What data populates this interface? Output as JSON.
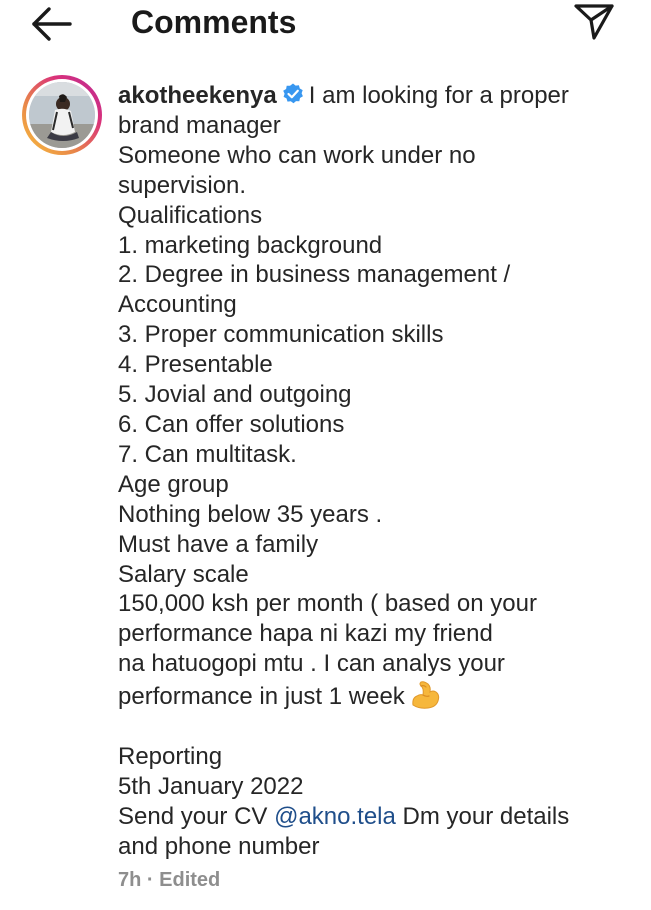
{
  "header": {
    "title": "Comments",
    "back_icon": "arrow-left-icon",
    "share_icon": "paper-plane-icon"
  },
  "comment": {
    "avatar_icon": "profile-avatar",
    "username": "akotheekenya",
    "verified_icon": "verified-badge-icon",
    "verified_color": "#3897f0",
    "first_line": "I am looking for a proper",
    "lines": [
      "brand manager",
      "Someone who can work under no",
      "supervision.",
      "Qualifications",
      "1. marketing background",
      "2. Degree in business management /",
      "Accounting",
      "3. Proper communication skills",
      "4. Presentable",
      "5. Jovial and outgoing",
      "6. Can offer solutions",
      "7. Can multitask.",
      "Age group",
      "Nothing below 35 years .",
      "Must have a family",
      "Salary scale",
      "150,000 ksh per month ( based on your",
      "performance hapa ni kazi my friend",
      "na hatuogopi mtu . I can analys your"
    ],
    "emoji_line": "performance in just 1 week",
    "emoji_icon": "flexed-biceps-emoji",
    "lines_after": [
      "Reporting",
      "5th January 2022"
    ],
    "cv_prefix": "Send your CV",
    "mention": "@akno.tela",
    "cv_suffix": " Dm your details",
    "last_line": "and phone number",
    "mention_color": "#1f4e8a"
  },
  "meta": {
    "time": "7h",
    "separator": "·",
    "edited": "Edited"
  }
}
